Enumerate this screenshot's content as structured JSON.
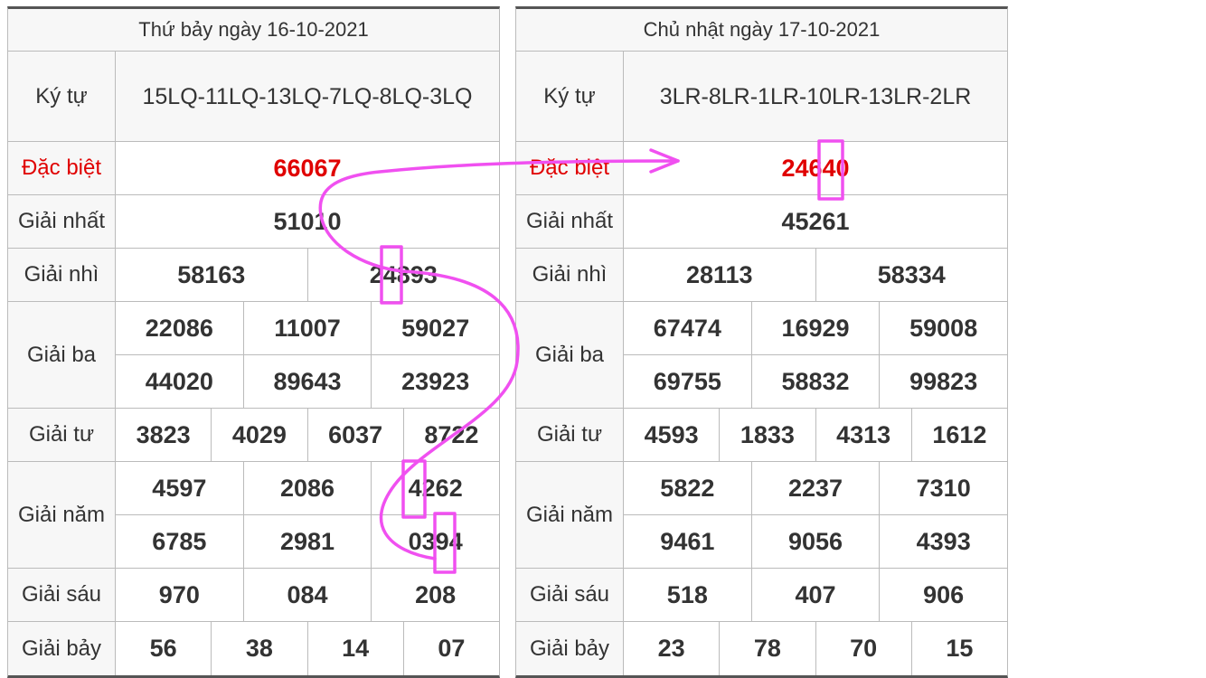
{
  "left": {
    "header": "Thứ bảy ngày 16-10-2021",
    "labels": {
      "kytu": "Ký tự",
      "db": "Đặc biệt",
      "g1": "Giải nhất",
      "g2": "Giải nhì",
      "g3": "Giải ba",
      "g4": "Giải tư",
      "g5": "Giải năm",
      "g6": "Giải sáu",
      "g7": "Giải bảy"
    },
    "kytu": "15LQ-11LQ-13LQ-7LQ-8LQ-3LQ",
    "db": "66067",
    "g1": "51010",
    "g2": [
      "58163",
      "24893"
    ],
    "g3": [
      "22086",
      "11007",
      "59027",
      "44020",
      "89643",
      "23923"
    ],
    "g4": [
      "3823",
      "4029",
      "6037",
      "8722"
    ],
    "g5": [
      "4597",
      "2086",
      "4262",
      "6785",
      "2981",
      "0394"
    ],
    "g6": [
      "970",
      "084",
      "208"
    ],
    "g7": [
      "56",
      "38",
      "14",
      "07"
    ]
  },
  "right": {
    "header": "Chủ nhật ngày 17-10-2021",
    "labels": {
      "kytu": "Ký tự",
      "db": "Đặc biệt",
      "g1": "Giải nhất",
      "g2": "Giải nhì",
      "g3": "Giải ba",
      "g4": "Giải tư",
      "g5": "Giải năm",
      "g6": "Giải sáu",
      "g7": "Giải bảy"
    },
    "kytu": "3LR-8LR-1LR-10LR-13LR-2LR",
    "db": "24640",
    "g1": "45261",
    "g2": [
      "28113",
      "58334"
    ],
    "g3": [
      "67474",
      "16929",
      "59008",
      "69755",
      "58832",
      "99823"
    ],
    "g4": [
      "4593",
      "1833",
      "4313",
      "1612"
    ],
    "g5": [
      "5822",
      "2237",
      "7310",
      "9461",
      "9056",
      "4393"
    ],
    "g6": [
      "518",
      "407",
      "906"
    ],
    "g7": [
      "23",
      "78",
      "70",
      "15"
    ]
  },
  "annotation": {
    "color": "#f050f0",
    "icon": "arrow-right-icon"
  }
}
